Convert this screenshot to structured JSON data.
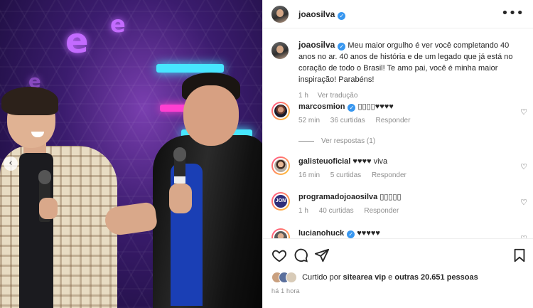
{
  "post": {
    "owner": "joaosilva",
    "more_icon": "more-horizontal-icon",
    "prev_icon": "chevron-left-icon"
  },
  "caption": {
    "username": "joaosilva",
    "text": "Meu maior orgulho é ver você completando 40 anos no ar. 40 anos de história e de um legado que já está no coração de todo o Brasil! Te amo pai, você é minha maior inspiração! Parabéns!",
    "time": "1 h",
    "translation": "Ver tradução"
  },
  "comments": [
    {
      "username": "marcosmion",
      "verified": true,
      "text": "▯▯▯▯♥♥♥♥",
      "time": "52 min",
      "likes": "36 curtidas",
      "reply": "Responder"
    },
    {
      "username": "galisteuoficial",
      "verified": false,
      "text": "♥♥♥♥ viva",
      "time": "16 min",
      "likes": "5 curtidas",
      "reply": "Responder"
    },
    {
      "username": "programadojoaosilva",
      "verified": false,
      "text": "▯▯▯▯▯",
      "time": "1 h",
      "likes": "40 curtidas",
      "reply": "Responder"
    },
    {
      "username": "lucianohuck",
      "verified": true,
      "text": "♥♥♥♥♥",
      "time": "",
      "likes": "",
      "reply": ""
    }
  ],
  "view_replies": "Ver respostas (1)",
  "actions": {
    "like_icon": "heart-icon",
    "comment_icon": "comment-icon",
    "share_icon": "send-icon",
    "save_icon": "bookmark-icon"
  },
  "likes": {
    "prefix": "Curtido por",
    "user": "sitearea vip",
    "user_display": "sitearea vip",
    "middle": "e",
    "others": "outras 20.651 pessoas"
  },
  "posted": "há 1 hora",
  "colors": {
    "verified": "#3897f0",
    "meta": "#8e8e8e",
    "text": "#262626"
  }
}
